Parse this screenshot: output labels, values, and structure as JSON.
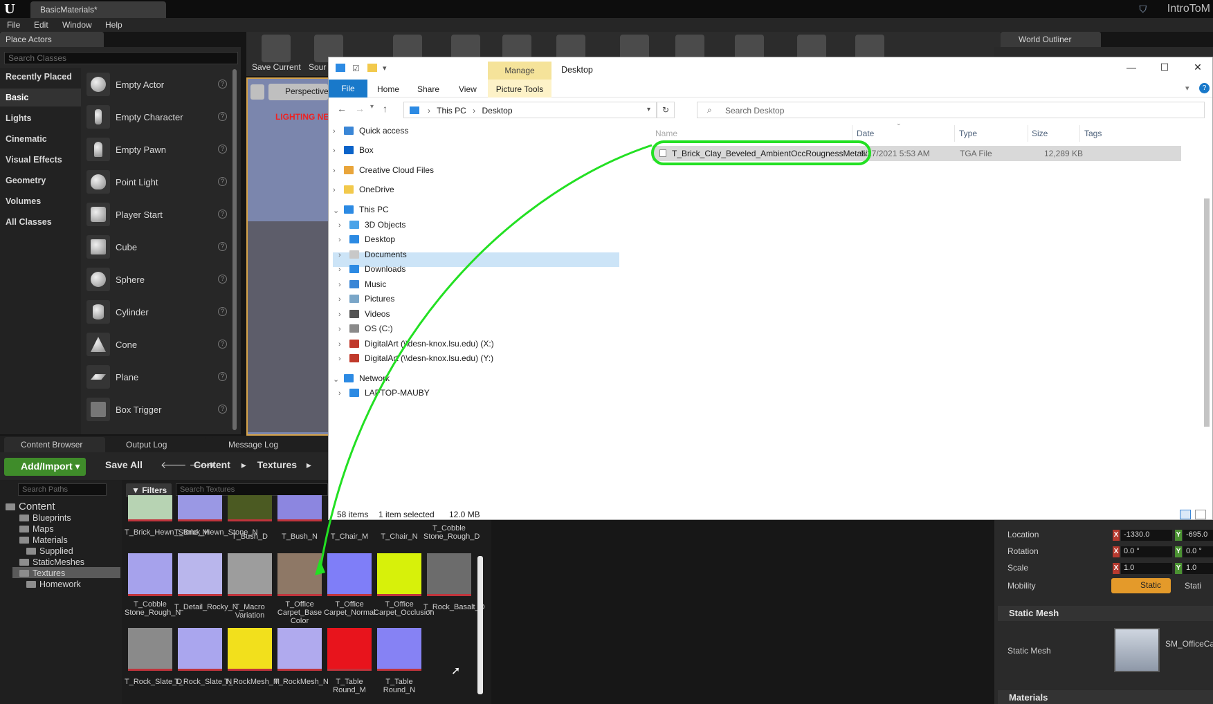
{
  "ue": {
    "doc_tab": "BasicMaterials*",
    "project": "IntroToM",
    "menu": [
      "File",
      "Edit",
      "Window",
      "Help"
    ]
  },
  "place_actors": {
    "tab": "Place Actors",
    "search_placeholder": "Search Classes",
    "categories": [
      "Recently Placed",
      "Basic",
      "Lights",
      "Cinematic",
      "Visual Effects",
      "Geometry",
      "Volumes",
      "All Classes"
    ],
    "active_category": "Basic",
    "actors": [
      "Empty Actor",
      "Empty Character",
      "Empty Pawn",
      "Point Light",
      "Player Start",
      "Cube",
      "Sphere",
      "Cylinder",
      "Cone",
      "Plane",
      "Box Trigger"
    ]
  },
  "toolbar": {
    "save_current": "Save Current",
    "source": "Sour"
  },
  "viewport": {
    "perspective": "Perspective",
    "lighting_warning": "LIGHTING NE"
  },
  "world_outliner": {
    "tab": "World Outliner"
  },
  "content_browser": {
    "tabs": [
      "Content Browser",
      "Output Log",
      "Message Log"
    ],
    "add_import": "Add/Import",
    "save_all": "Save All",
    "path": [
      "Content",
      "Textures"
    ],
    "search_paths_placeholder": "Search Paths",
    "filters": "Filters",
    "search_textures_placeholder": "Search Textures",
    "tree": {
      "root": "Content",
      "items": [
        "Blueprints",
        "Maps",
        "Materials",
        "Supplied",
        "StaticMeshes",
        "Textures",
        "Homework"
      ]
    },
    "row1": [
      "T_Brick_Hewn_Stone_M",
      "T_Brick_Hewn_Stone_N",
      "T_Bush_D",
      "T_Bush_N",
      "T_Chair_M",
      "T_Chair_N",
      "T_Cobble Stone_Rough_D"
    ],
    "row2": [
      "T_Cobble Stone_Rough_N",
      "T_Detail_Rocky_N",
      "T_Macro Variation",
      "T_Office Carpet_Base Color",
      "T_Office Carpet_Normal",
      "T_Office Carpet_Occlusion",
      "T_Rock_Basalt_D"
    ],
    "row3": [
      "T_Rock_Slate_D",
      "T_Rock_Slate_N",
      "T_RockMesh_M",
      "T_RockMesh_N",
      "T_Table Round_M",
      "T_Table Round_N"
    ]
  },
  "details": {
    "location": "Location",
    "rotation": "Rotation",
    "scale": "Scale",
    "mobility": "Mobility",
    "location_x": "-1330.0",
    "location_y": "-695.0",
    "rotation_x": "0.0 °",
    "rotation_y": "0.0 °",
    "scale_x": "1.0",
    "scale_y": "1.0",
    "mobility_static": "Static",
    "mobility_other": "Stati",
    "section_static_mesh": "Static Mesh",
    "static_mesh_label": "Static Mesh",
    "static_mesh_value": "SM_OfficeCa",
    "section_materials": "Materials"
  },
  "explorer": {
    "manage": "Manage",
    "title": "Desktop",
    "tabs": [
      "File",
      "Home",
      "Share",
      "View"
    ],
    "picture_tools": "Picture Tools",
    "address": [
      "This PC",
      "Desktop"
    ],
    "search_placeholder": "Search Desktop",
    "nav": {
      "quick_access": "Quick access",
      "box": "Box",
      "creative_cloud": "Creative Cloud Files",
      "onedrive": "OneDrive",
      "this_pc": "This PC",
      "objects3d": "3D Objects",
      "desktop": "Desktop",
      "documents": "Documents",
      "downloads": "Downloads",
      "music": "Music",
      "pictures": "Pictures",
      "videos": "Videos",
      "os": "OS (C:)",
      "digital_x": "DigitalArt (\\\\desn-knox.lsu.edu) (X:)",
      "digital_y": "DigitalArt (\\\\desn-knox.lsu.edu) (Y:)",
      "network": "Network",
      "laptop": "LAPTOP-MAUBY"
    },
    "columns": [
      "Name",
      "Date",
      "Type",
      "Size",
      "Tags"
    ],
    "file": {
      "name": "T_Brick_Clay_Beveled_AmbientOccRougnessMetalic....",
      "date": "8/27/2021 5:53 AM",
      "type": "TGA File",
      "size": "12,289 KB"
    },
    "status": {
      "items": "58 items",
      "selected": "1 item selected",
      "size": "12.0 MB"
    }
  },
  "colors": {
    "highlight": "#23e023",
    "add_import": "#3f8c2a",
    "static_button": "#e49a2a",
    "selection": "#cce4f7"
  }
}
